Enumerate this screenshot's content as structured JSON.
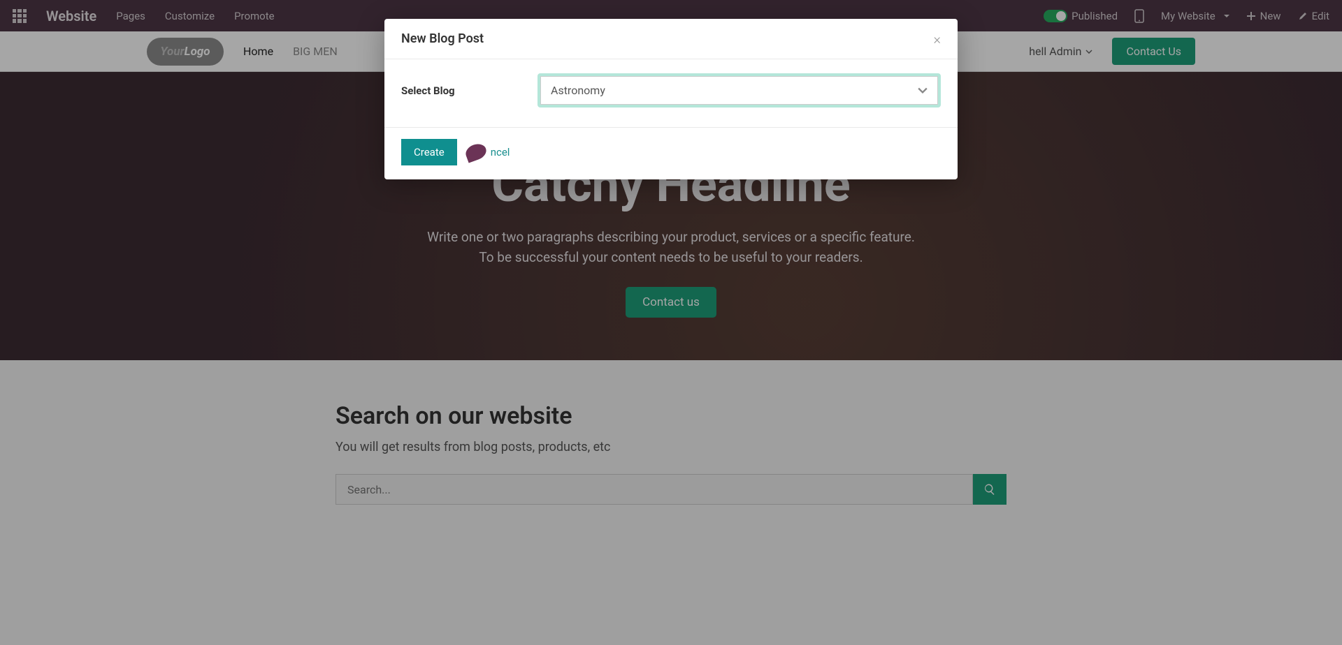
{
  "topbar": {
    "brand": "Website",
    "items": [
      "Pages",
      "Customize",
      "Promote"
    ],
    "published": "Published",
    "my_website": "My Website",
    "new": "New",
    "edit": "Edit"
  },
  "sitenav": {
    "logo_left": "Your",
    "logo_right": "Logo",
    "home": "Home",
    "bigmen": "BIG MEN",
    "admin": "hell Admin",
    "contact": "Contact Us"
  },
  "hero": {
    "headline": "Catchy Headline",
    "p1": "Write one or two paragraphs describing your product, services or a specific feature.",
    "p2": "To be successful your content needs to be useful to your readers.",
    "cta": "Contact us"
  },
  "search": {
    "title": "Search on our website",
    "sub": "You will get results from blog posts, products, etc",
    "placeholder": "Search..."
  },
  "modal": {
    "title": "New Blog Post",
    "label": "Select Blog",
    "selected": "Astronomy",
    "create": "Create",
    "cancel_fragment": "ncel"
  }
}
